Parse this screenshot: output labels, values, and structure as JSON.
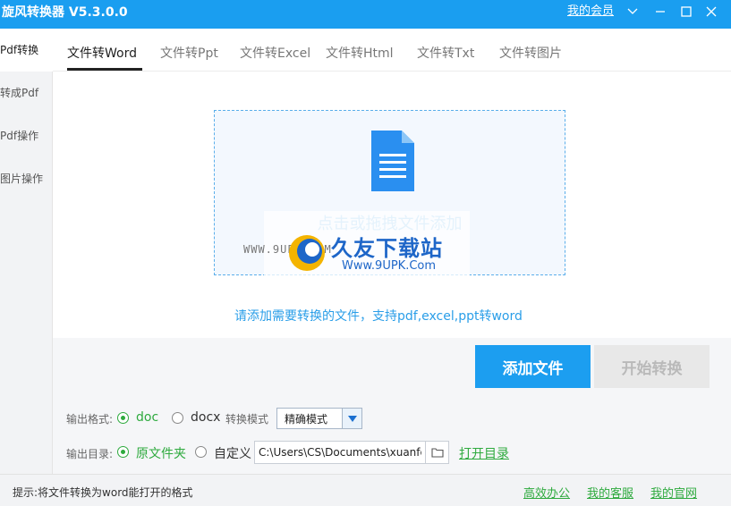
{
  "window": {
    "title": "旋风转换器 V5.3.0.0",
    "member_link": "我的会员",
    "accent_color": "#1a9ef0"
  },
  "sidebar": {
    "items": [
      {
        "label": "Pdf转换",
        "active": true
      },
      {
        "label": "转成Pdf",
        "active": false
      },
      {
        "label": "Pdf操作",
        "active": false
      },
      {
        "label": "图片操作",
        "active": false
      }
    ]
  },
  "tabs": [
    {
      "label": "文件转Word",
      "active": true
    },
    {
      "label": "文件转Ppt",
      "active": false
    },
    {
      "label": "文件转Excel",
      "active": false
    },
    {
      "label": "文件转Html",
      "active": false
    },
    {
      "label": "文件转Txt",
      "active": false
    },
    {
      "label": "文件转图片",
      "active": false
    }
  ],
  "dropzone": {
    "icon": "document-icon",
    "text": "点击或拖拽文件添加"
  },
  "watermark": {
    "www": "WWW.9UPK.COM",
    "name": "久友下载站",
    "url": "Www.9UPK.Com"
  },
  "hint": "请添加需要转换的文件，支持pdf,excel,ppt转word",
  "buttons": {
    "add": "添加文件",
    "start": "开始转换"
  },
  "output_format": {
    "label": "输出格式:",
    "options": [
      "doc",
      "docx"
    ],
    "selected": "doc",
    "mode_label": "转换模式",
    "mode_value": "精确模式"
  },
  "output_dir": {
    "label": "输出目录:",
    "options": [
      "原文件夹",
      "自定义"
    ],
    "selected": "原文件夹",
    "path": "C:\\Users\\CS\\Documents\\xuanfeng",
    "open_link": "打开目录"
  },
  "status": {
    "text": "提示:将文件转换为word能打开的格式",
    "links": [
      "高效办公",
      "我的客服",
      "我的官网"
    ]
  }
}
